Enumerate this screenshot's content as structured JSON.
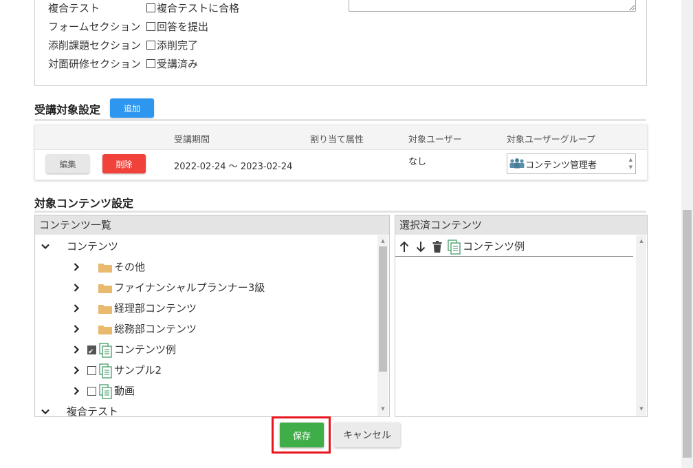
{
  "completion_conditions": [
    {
      "label": "複合テスト",
      "checkbox_label": "複合テストに合格"
    },
    {
      "label": "フォームセクション",
      "checkbox_label": "回答を提出"
    },
    {
      "label": "添削課題セクション",
      "checkbox_label": "添削完了"
    },
    {
      "label": "対面研修セクション",
      "checkbox_label": "受講済み"
    }
  ],
  "enrollment": {
    "title": "受講対象設定",
    "add_label": "追加",
    "columns": {
      "period": "受講期間",
      "attribute": "割り当て属性",
      "users": "対象ユーザー",
      "groups": "対象ユーザーグループ"
    },
    "rows": [
      {
        "edit_label": "編集",
        "delete_label": "削除",
        "period": "2022-02-24 ～ 2023-02-24",
        "attribute": "",
        "users": "なし",
        "group": "コンテンツ管理者"
      }
    ]
  },
  "contents": {
    "title": "対象コンテンツ設定",
    "list_title": "コンテンツ一覧",
    "selected_title": "選択済コンテンツ",
    "tree": [
      {
        "label": "コンテンツ",
        "icon": "chevron-down"
      },
      {
        "label": "その他",
        "icon": "folder-icon"
      },
      {
        "label": "ファイナンシャルプランナー3級",
        "icon": "folder-icon"
      },
      {
        "label": "経理部コンテンツ",
        "icon": "folder-icon"
      },
      {
        "label": "総務部コンテンツ",
        "icon": "folder-icon"
      },
      {
        "label": "コンテンツ例",
        "icon": "documents-icon",
        "checked": true
      },
      {
        "label": "サンプル2",
        "icon": "documents-icon",
        "checked": false
      },
      {
        "label": "動画",
        "icon": "documents-icon",
        "checked": false
      },
      {
        "label": "複合テスト",
        "icon": "chevron-down"
      }
    ],
    "selected": [
      {
        "label": "コンテンツ例",
        "icon": "documents-icon"
      }
    ]
  },
  "footer": {
    "save_label": "保存",
    "cancel_label": "キャンセル"
  },
  "colors": {
    "primary": "#2d96ee",
    "danger": "#f0413a",
    "success": "#3fae49",
    "highlight": "#e8141c",
    "folder": "#e9b96e",
    "doc": "#5ba87a"
  }
}
